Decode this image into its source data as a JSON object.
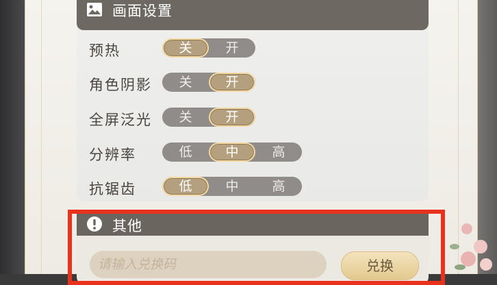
{
  "graphics": {
    "title": "画面设置",
    "rows": [
      {
        "label": "预热",
        "options": [
          "关",
          "开"
        ],
        "selected": 0
      },
      {
        "label": "角色阴影",
        "options": [
          "关",
          "开"
        ],
        "selected": 1
      },
      {
        "label": "全屏泛光",
        "options": [
          "关",
          "开"
        ],
        "selected": 1
      },
      {
        "label": "分辨率",
        "options": [
          "低",
          "中",
          "高"
        ],
        "selected": 1
      },
      {
        "label": "抗锯齿",
        "options": [
          "低",
          "中",
          "高"
        ],
        "selected": 0
      }
    ]
  },
  "other": {
    "title": "其他",
    "code_placeholder": "请输入兑换码",
    "redeem_label": "兑换"
  },
  "colors": {
    "header_bg": "#6e6862",
    "selected_option": "#b4a07e",
    "highlight_box": "#e8321e"
  }
}
